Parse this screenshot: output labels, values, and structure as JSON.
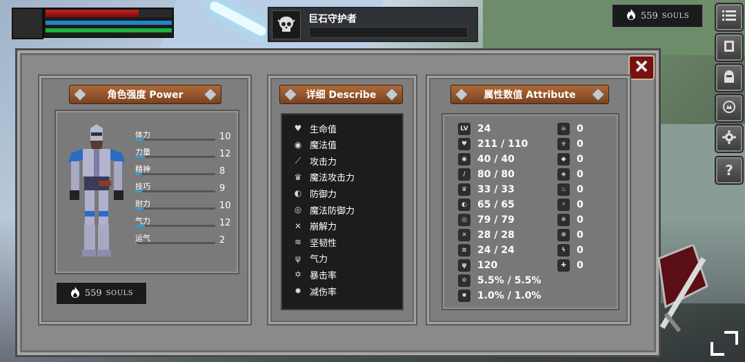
{
  "hud": {
    "hp": 0.74,
    "mp": 1.0,
    "sp": 1.0
  },
  "boss": {
    "name": "巨石守护者",
    "health": 0
  },
  "souls_top": {
    "amount": "559",
    "unit": "SOULS"
  },
  "side_menu": [
    "menu-icon",
    "armor-icon",
    "helmet-icon",
    "emblem-icon",
    "gear-icon",
    "help-icon"
  ],
  "panels": {
    "power": {
      "title": "角色强度 Power",
      "stats": [
        {
          "label": "体力",
          "value": "10",
          "fill": 0.1
        },
        {
          "label": "力量",
          "value": "12",
          "fill": 0.12
        },
        {
          "label": "精神",
          "value": "8",
          "fill": 0.08
        },
        {
          "label": "技巧",
          "value": "9",
          "fill": 0.09
        },
        {
          "label": "耐力",
          "value": "10",
          "fill": 0.1
        },
        {
          "label": "气力",
          "value": "12",
          "fill": 0.12
        },
        {
          "label": "运气",
          "value": "2",
          "fill": 0.02
        }
      ],
      "souls": {
        "amount": "559",
        "unit": "SOULS"
      }
    },
    "describe": {
      "title": "详细 Describe",
      "items": [
        "生命值",
        "魔法值",
        "攻击力",
        "魔法攻击力",
        "防御力",
        "魔法防御力",
        "崩解力",
        "坚韧性",
        "气力",
        "暴击率",
        "减伤率"
      ]
    },
    "attribute": {
      "title": "属性数值 Attribute",
      "left": [
        {
          "icon": "LV",
          "value": "24"
        },
        {
          "icon": "♥",
          "value": "211 / 110"
        },
        {
          "icon": "◉",
          "value": "40 / 40"
        },
        {
          "icon": "/",
          "value": "80 / 80"
        },
        {
          "icon": "♛",
          "value": "33 / 33"
        },
        {
          "icon": "◐",
          "value": "65 / 65"
        },
        {
          "icon": "◎",
          "value": "79 / 79"
        },
        {
          "icon": "✕",
          "value": "28 / 28"
        },
        {
          "icon": "≋",
          "value": "24 / 24"
        },
        {
          "icon": "ψ",
          "value": "120"
        },
        {
          "icon": "✡",
          "value": "5.5% / 5.5%"
        },
        {
          "icon": "✹",
          "value": "1.0% / 1.0%"
        }
      ],
      "right": [
        {
          "icon": "☠",
          "value": "0"
        },
        {
          "icon": "☣",
          "value": "0"
        },
        {
          "icon": "◆",
          "value": "0"
        },
        {
          "icon": "◈",
          "value": "0"
        },
        {
          "icon": "♨",
          "value": "0"
        },
        {
          "icon": "⚡",
          "value": "0"
        },
        {
          "icon": "❄",
          "value": "0"
        },
        {
          "icon": "✻",
          "value": "0"
        },
        {
          "icon": "ϟ",
          "value": "0"
        },
        {
          "icon": "✚",
          "value": "0"
        }
      ]
    }
  },
  "colors": {
    "hp": "#c32323",
    "mp": "#1f86c8",
    "sp": "#1fb043",
    "plank": "#9a5a2c",
    "stat_bar": "#2aa0d8"
  }
}
